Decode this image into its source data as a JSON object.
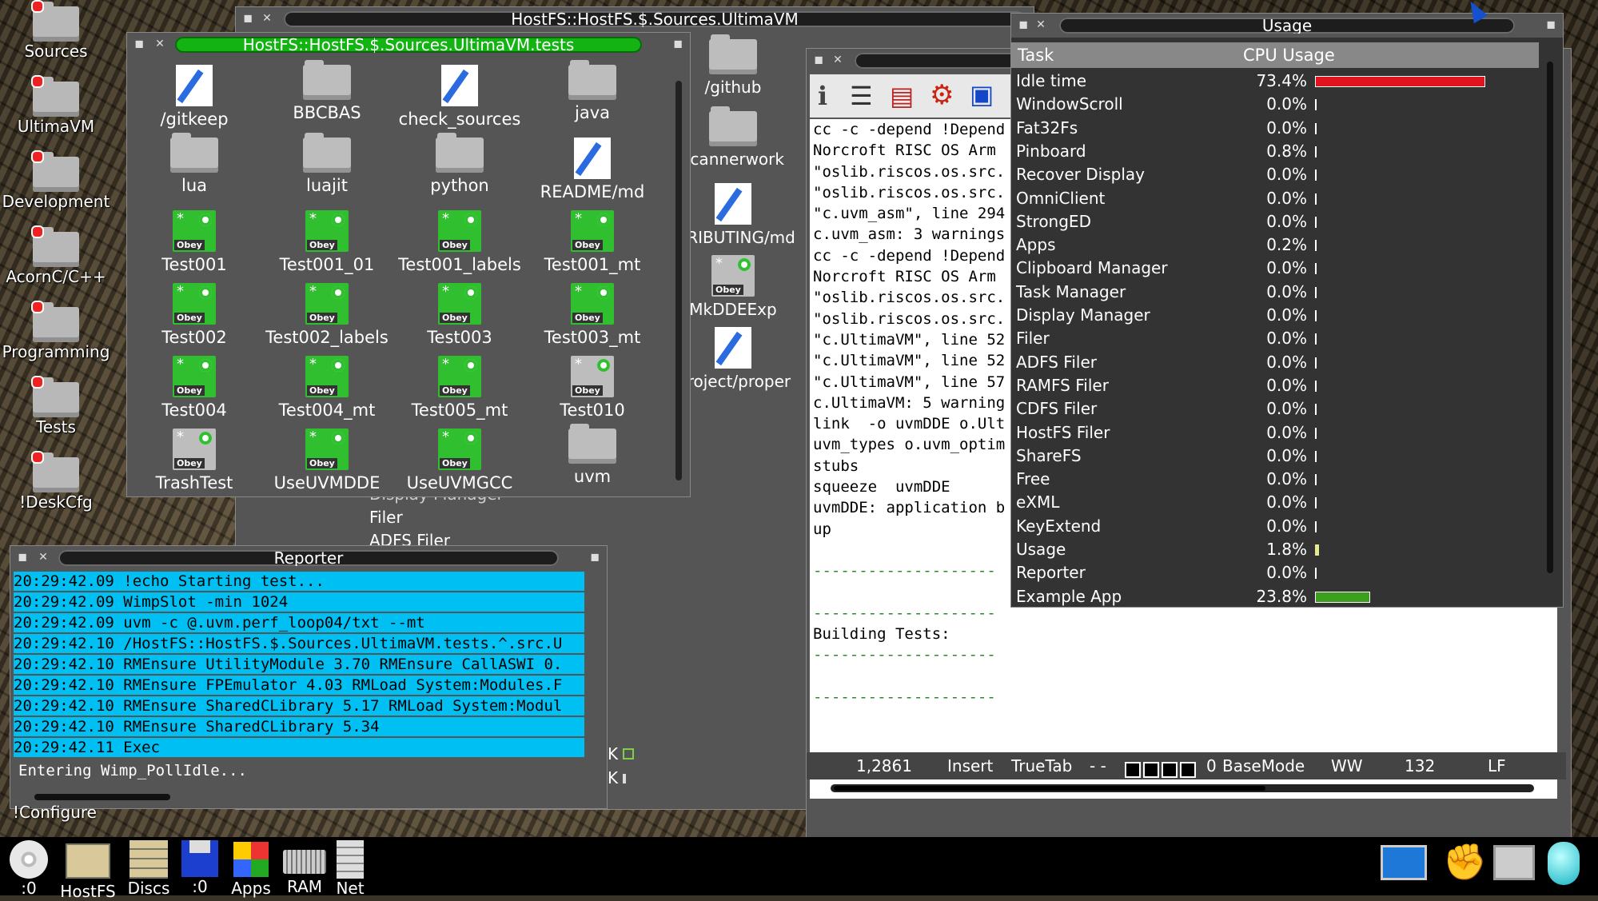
{
  "desktop": {
    "icons": [
      "Sources",
      "UltimaVM",
      "Development",
      "AcornC/C++",
      "Programming",
      "Tests",
      "!DeskCfg"
    ],
    "configure_label": "!Configure"
  },
  "filer_back": {
    "title": "HostFS::HostFS.$.Sources.UltimaVM"
  },
  "filer_tests": {
    "title": "HostFS::HostFS.$.Sources.UltimaVM.tests",
    "items": [
      {
        "label": "/gitkeep",
        "kind": "doc"
      },
      {
        "label": "BBCBAS",
        "kind": "folder"
      },
      {
        "label": "check_sources",
        "kind": "doc"
      },
      {
        "label": "java",
        "kind": "folder"
      },
      {
        "label": "lua",
        "kind": "folder"
      },
      {
        "label": "luajit",
        "kind": "folder"
      },
      {
        "label": "python",
        "kind": "folder"
      },
      {
        "label": "README/md",
        "kind": "doc"
      },
      {
        "label": "Test001",
        "kind": "obey"
      },
      {
        "label": "Test001_01",
        "kind": "obey"
      },
      {
        "label": "Test001_labels",
        "kind": "obey"
      },
      {
        "label": "Test001_mt",
        "kind": "obey"
      },
      {
        "label": "Test002",
        "kind": "obey"
      },
      {
        "label": "Test002_labels",
        "kind": "obey"
      },
      {
        "label": "Test003",
        "kind": "obey"
      },
      {
        "label": "Test003_mt",
        "kind": "obey"
      },
      {
        "label": "Test004",
        "kind": "obey"
      },
      {
        "label": "Test004_mt",
        "kind": "obey"
      },
      {
        "label": "Test005_mt",
        "kind": "obey"
      },
      {
        "label": "Test010",
        "kind": "obey-grey"
      },
      {
        "label": "TrashTest",
        "kind": "obey-grey"
      },
      {
        "label": "UseUVMDDE",
        "kind": "obey"
      },
      {
        "label": "UseUVMGCC",
        "kind": "obey"
      },
      {
        "label": "uvm",
        "kind": "folder"
      }
    ],
    "obey_badge": "Obey"
  },
  "filer_back_items": [
    "/github",
    "scannerwork",
    "TRIBUTING/md",
    "MkDDEExp",
    "project/proper"
  ],
  "behind_text": {
    "items": [
      "Display Manager",
      "Filer",
      "ADFS Filer"
    ]
  },
  "editor": {
    "lines": [
      "cc -c -depend !Depend",
      "Norcroft RISC OS Arm",
      "\"oslib.riscos.os.src.",
      "\"oslib.riscos.os.src.",
      "\"c.uvm_asm\", line 294",
      "c.uvm_asm: 3 warnings",
      "cc -c -depend !Depend",
      "Norcroft RISC OS Arm",
      "\"oslib.riscos.os.src.",
      "\"oslib.riscos.os.src.",
      "\"c.UltimaVM\", line 52",
      "\"c.UltimaVM\", line 52",
      "\"c.UltimaVM\", line 57",
      "c.UltimaVM: 5 warning",
      "link  -o uvmDDE o.Ult",
      "uvm_types o.uvm_optim",
      "stubs",
      "squeeze  uvmDDE",
      "uvmDDE: application b",
      "up",
      "",
      "--------------------",
      "",
      "--------------------",
      "Building Tests:",
      "--------------------",
      "",
      "--------------------"
    ],
    "status": {
      "pos": "1,2861",
      "mode": "Insert",
      "tab": "TrueTab",
      "dashes": "- -",
      "count": "0",
      "basemode": "BaseMode",
      "ww": "WW",
      "col": "132",
      "eol": "LF"
    }
  },
  "usage": {
    "title": "Usage",
    "header_task": "Task",
    "header_cpu": "CPU Usage",
    "rows": [
      {
        "name": "Idle time",
        "pct": "73.4%",
        "value": 73.4,
        "color": "#e0141e"
      },
      {
        "name": "WindowScroll",
        "pct": "0.0%",
        "value": 0,
        "color": "#ffffff"
      },
      {
        "name": "Fat32Fs",
        "pct": "0.0%",
        "value": 0,
        "color": "#ffffff"
      },
      {
        "name": "Pinboard",
        "pct": "0.8%",
        "value": 0.8,
        "color": "#ffffff"
      },
      {
        "name": "Recover Display",
        "pct": "0.0%",
        "value": 0,
        "color": "#ffffff"
      },
      {
        "name": "OmniClient",
        "pct": "0.0%",
        "value": 0,
        "color": "#ffffff"
      },
      {
        "name": "StrongED",
        "pct": "0.0%",
        "value": 0,
        "color": "#ffffff"
      },
      {
        "name": "Apps",
        "pct": "0.2%",
        "value": 0.2,
        "color": "#ffffff"
      },
      {
        "name": "Clipboard Manager",
        "pct": "0.0%",
        "value": 0,
        "color": "#ffffff"
      },
      {
        "name": "Task Manager",
        "pct": "0.0%",
        "value": 0,
        "color": "#ffffff"
      },
      {
        "name": "Display Manager",
        "pct": "0.0%",
        "value": 0,
        "color": "#ffffff"
      },
      {
        "name": "Filer",
        "pct": "0.0%",
        "value": 0,
        "color": "#ffffff"
      },
      {
        "name": "ADFS Filer",
        "pct": "0.0%",
        "value": 0,
        "color": "#ffffff"
      },
      {
        "name": "RAMFS Filer",
        "pct": "0.0%",
        "value": 0,
        "color": "#ffffff"
      },
      {
        "name": "CDFS Filer",
        "pct": "0.0%",
        "value": 0,
        "color": "#ffffff"
      },
      {
        "name": "HostFS Filer",
        "pct": "0.0%",
        "value": 0,
        "color": "#ffffff"
      },
      {
        "name": "ShareFS",
        "pct": "0.0%",
        "value": 0,
        "color": "#ffffff"
      },
      {
        "name": "Free",
        "pct": "0.0%",
        "value": 0,
        "color": "#ffffff"
      },
      {
        "name": "eXML",
        "pct": "0.0%",
        "value": 0,
        "color": "#ffffff"
      },
      {
        "name": "KeyExtend",
        "pct": "0.0%",
        "value": 0,
        "color": "#ffffff"
      },
      {
        "name": "Usage",
        "pct": "1.8%",
        "value": 1.8,
        "color": "#e8e890"
      },
      {
        "name": "Reporter",
        "pct": "0.0%",
        "value": 0,
        "color": "#ffffff"
      },
      {
        "name": "Example App",
        "pct": "23.8%",
        "value": 23.8,
        "color": "#3ca01e"
      }
    ]
  },
  "reporter": {
    "title": "Reporter",
    "lines": [
      "20:29:42.09 !echo Starting test...",
      "20:29:42.09 WimpSlot -min 1024",
      "20:29:42.09 uvm -c @.uvm.perf_loop04/txt --mt",
      "20:29:42.10 /HostFS::HostFS.$.Sources.UltimaVM.tests.^.src.U",
      "20:29:42.10 RMEnsure UtilityModule 3.70 RMEnsure CallASWI 0.",
      "20:29:42.10 RMEnsure FPEmulator 4.03 RMLoad System:Modules.F",
      "20:29:42.10 RMEnsure SharedCLibrary 5.17 RMLoad System:Modul",
      "20:29:42.10 RMEnsure SharedCLibrary 5.34",
      "20:29:42.11 Exec"
    ],
    "last_line": "Entering Wimp_PollIdle..."
  },
  "iconbar": {
    "items": [
      ":0",
      "HostFS",
      "Discs",
      ":0",
      "Apps",
      "RAM",
      "Net"
    ]
  },
  "colors": {
    "reporter_highlight": "#00bff2",
    "window_bg": "#555555",
    "title_green": "#13b313"
  }
}
